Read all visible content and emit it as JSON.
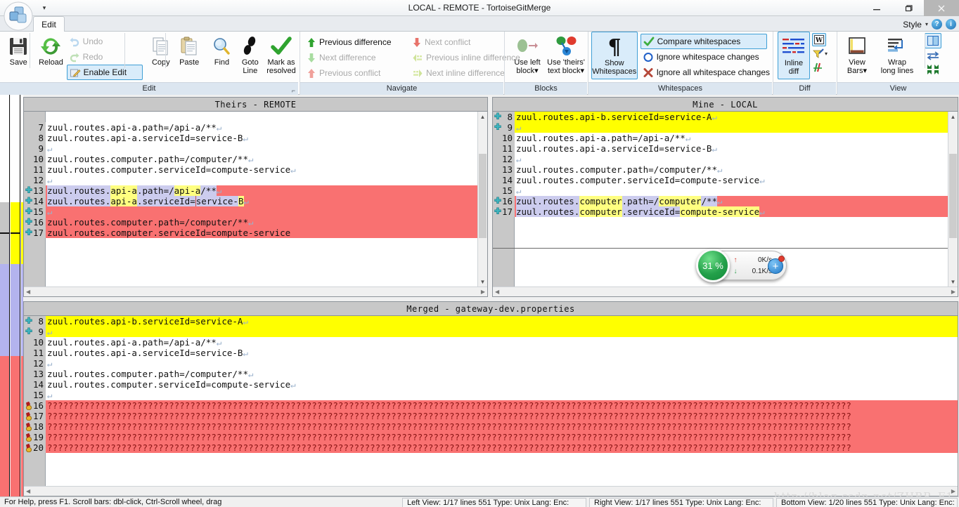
{
  "window": {
    "title": "LOCAL - REMOTE - TortoiseGitMerge",
    "minimize": "–",
    "maximize": "❐",
    "close": "×",
    "qat_icon": "quick-access-dropdown"
  },
  "ribbon": {
    "tab": "Edit",
    "style_label": "Style",
    "style_arrow": "▾",
    "help_glyph": "?",
    "info_glyph": "i",
    "groups": [
      {
        "name": "Edit",
        "label": "Edit",
        "big_buttons": [
          {
            "label": "Save",
            "icon": "floppy-disk-icon",
            "enabled": true
          },
          {
            "label": "Reload",
            "icon": "reload-arrows-icon",
            "enabled": true
          },
          {
            "label": "Copy",
            "icon": "copy-pages-icon",
            "enabled": true
          },
          {
            "label": "Paste",
            "icon": "paste-clipboard-icon",
            "enabled": false
          },
          {
            "label": "Find",
            "icon": "magnifier-icon",
            "enabled": true
          },
          {
            "label": "Goto\nLine",
            "label_l1": "Goto",
            "label_l2": "Line",
            "icon": "footprints-icon",
            "enabled": true
          },
          {
            "label": "Mark as resolved",
            "label_l1": "Mark as",
            "label_l2": "resolved",
            "icon": "green-check-icon",
            "enabled": true
          }
        ],
        "small_buttons": [
          {
            "label": "Undo",
            "icon": "undo-arrow-icon",
            "enabled": false
          },
          {
            "label": "Redo",
            "icon": "redo-arrow-icon",
            "enabled": false
          },
          {
            "label": "Enable Edit",
            "icon": "pencil-edit-icon",
            "enabled": true,
            "selected": true
          }
        ]
      },
      {
        "name": "Navigate",
        "label": "Navigate",
        "small_buttons": [
          {
            "label": "Previous difference",
            "icon": "arrow-up-green-icon",
            "enabled": true
          },
          {
            "label": "Next conflict",
            "icon": "arrow-down-red-icon",
            "enabled": false
          },
          {
            "label": "Next difference",
            "icon": "arrow-down-green-icon",
            "enabled": false
          },
          {
            "label": "Previous inline difference",
            "icon": "inline-prev-icon",
            "enabled": false
          },
          {
            "label": "Previous conflict",
            "icon": "arrow-up-red-icon",
            "enabled": false
          },
          {
            "label": "Next inline difference",
            "icon": "inline-next-icon",
            "enabled": false
          }
        ]
      },
      {
        "name": "Blocks",
        "label": "Blocks",
        "big_buttons": [
          {
            "label_l1": "Use left",
            "label_l2": "block",
            "icon": "use-left-block-icon",
            "enabled": false,
            "dropdown": true
          },
          {
            "label_l1": "Use 'theirs'",
            "label_l2": "text block",
            "icon": "use-theirs-block-icon",
            "enabled": true,
            "dropdown": true
          }
        ]
      },
      {
        "name": "Whitespaces",
        "label": "Whitespaces",
        "big_buttons": [
          {
            "label_l1": "Show",
            "label_l2": "Whitespaces",
            "icon": "pilcrow-icon",
            "enabled": true,
            "selected": true
          }
        ],
        "small_buttons": [
          {
            "label": "Compare whitespaces",
            "icon": "green-check-icon",
            "enabled": true,
            "selected": true
          },
          {
            "label": "Ignore whitespace changes",
            "icon": "blue-circle-icon",
            "enabled": true
          },
          {
            "label": "Ignore all whitespace changes",
            "icon": "red-x-icon",
            "enabled": true
          }
        ]
      },
      {
        "name": "Diff",
        "label": "Diff",
        "big_buttons": [
          {
            "label_l1": "Inline",
            "label_l2": "diff",
            "icon": "inline-diff-lines-icon",
            "enabled": true,
            "selected": true
          }
        ],
        "side_icons": [
          {
            "icon": "word-diff-icon",
            "selected": true
          },
          {
            "icon": "highlighter-pen-icon",
            "dropdown": true
          },
          {
            "icon": "hash-strokes-icon"
          }
        ]
      },
      {
        "name": "View",
        "label": "View",
        "big_buttons": [
          {
            "label_l1": "View",
            "label_l2": "Bars",
            "icon": "view-bars-icon",
            "enabled": true,
            "dropdown": true
          },
          {
            "label_l1": "Wrap",
            "label_l2": "long lines",
            "icon": "wrap-lines-icon",
            "enabled": true
          }
        ],
        "side_icons": [
          {
            "icon": "two-pane-layout-icon",
            "selected": true
          },
          {
            "icon": "swap-arrows-icon"
          },
          {
            "icon": "collapse-arrows-icon"
          }
        ]
      }
    ]
  },
  "panes": {
    "left": {
      "title": "Theirs - REMOTE",
      "lines": [
        {
          "num": "",
          "text": "",
          "bg": "blank-gray",
          "mark": ""
        },
        {
          "num": "7",
          "text": "zuul.routes.api-a.path=/api-a/**",
          "eol": true,
          "bg": "white",
          "mark": ""
        },
        {
          "num": "8",
          "text": "zuul.routes.api-a.serviceId=service-B",
          "eol": true,
          "bg": "white",
          "mark": ""
        },
        {
          "num": "9",
          "text": "",
          "eol": true,
          "bg": "white",
          "mark": ""
        },
        {
          "num": "10",
          "text": "zuul.routes.computer.path=/computer/**",
          "eol": true,
          "bg": "white",
          "mark": ""
        },
        {
          "num": "11",
          "text": "zuul.routes.computer.serviceId=compute-service",
          "eol": true,
          "bg": "white",
          "mark": ""
        },
        {
          "num": "12",
          "text": "",
          "eol": true,
          "bg": "white",
          "mark": ""
        },
        {
          "num": "13",
          "text": "zuul.routes.api-a.path=/api-a/**",
          "eol": true,
          "bg": "red",
          "mark": "plus",
          "inline": true
        },
        {
          "num": "14",
          "text": "zuul.routes.api-a.serviceId=service-B",
          "eol": true,
          "bg": "red",
          "mark": "plus",
          "inline": true
        },
        {
          "num": "15",
          "text": "",
          "eol": true,
          "bg": "red",
          "mark": "plus"
        },
        {
          "num": "16",
          "text": "zuul.routes.computer.path=/computer/**",
          "eol": true,
          "bg": "red",
          "mark": "plus"
        },
        {
          "num": "17",
          "text": "zuul.routes.computer.serviceId=compute-service",
          "eol": false,
          "bg": "red",
          "mark": "plus"
        }
      ]
    },
    "right": {
      "title": "Mine - LOCAL",
      "lines": [
        {
          "num": "8",
          "text": "zuul.routes.api-b.serviceId=service-A",
          "eol": true,
          "bg": "yellow",
          "mark": "plus"
        },
        {
          "num": "9",
          "text": "",
          "eol": true,
          "bg": "yellow",
          "mark": "plus"
        },
        {
          "num": "10",
          "text": "zuul.routes.api-a.path=/api-a/**",
          "eol": true,
          "bg": "white",
          "mark": ""
        },
        {
          "num": "11",
          "text": "zuul.routes.api-a.serviceId=service-B",
          "eol": true,
          "bg": "white",
          "mark": ""
        },
        {
          "num": "12",
          "text": "",
          "eol": true,
          "bg": "white",
          "mark": ""
        },
        {
          "num": "13",
          "text": "zuul.routes.computer.path=/computer/**",
          "eol": true,
          "bg": "white",
          "mark": ""
        },
        {
          "num": "14",
          "text": "zuul.routes.computer.serviceId=compute-service",
          "eol": true,
          "bg": "white",
          "mark": ""
        },
        {
          "num": "15",
          "text": "",
          "eol": true,
          "bg": "white",
          "mark": ""
        },
        {
          "num": "16",
          "text": "zuul.routes.computer.path=/computer/**",
          "eol": true,
          "bg": "red",
          "mark": "plus",
          "inline": true
        },
        {
          "num": "17",
          "text": "zuul.routes.computer.serviceId=compute-service",
          "eol": true,
          "bg": "red",
          "mark": "plus",
          "inline": true
        },
        {
          "num": "",
          "text": "",
          "bg": "red",
          "mark": ""
        },
        {
          "num": "",
          "text": "",
          "bg": "red",
          "mark": ""
        },
        {
          "num": "",
          "text": "",
          "bg": "red",
          "mark": ""
        }
      ]
    },
    "merged": {
      "title": "Merged - gateway-dev.properties",
      "lines": [
        {
          "num": "8",
          "text": "zuul.routes.api-b.serviceId=service-A",
          "eol": true,
          "bg": "yellow",
          "mark": "plus"
        },
        {
          "num": "9",
          "text": "",
          "eol": true,
          "bg": "yellow",
          "mark": "plus"
        },
        {
          "num": "10",
          "text": "zuul.routes.api-a.path=/api-a/**",
          "eol": true,
          "bg": "white",
          "mark": ""
        },
        {
          "num": "11",
          "text": "zuul.routes.api-a.serviceId=service-B",
          "eol": true,
          "bg": "white",
          "mark": ""
        },
        {
          "num": "12",
          "text": "",
          "eol": true,
          "bg": "white",
          "mark": ""
        },
        {
          "num": "13",
          "text": "zuul.routes.computer.path=/computer/**",
          "eol": true,
          "bg": "white",
          "mark": ""
        },
        {
          "num": "14",
          "text": "zuul.routes.computer.serviceId=compute-service",
          "eol": true,
          "bg": "white",
          "mark": ""
        },
        {
          "num": "15",
          "text": "",
          "eol": true,
          "bg": "white",
          "mark": ""
        },
        {
          "num": "16",
          "text": "????????????????????????????????????????????????????????????????????????????????????????????????????????????????????????????????????????????????????????",
          "bg": "red",
          "mark": "conflict"
        },
        {
          "num": "17",
          "text": "????????????????????????????????????????????????????????????????????????????????????????????????????????????????????????????????????????????????????????",
          "bg": "red",
          "mark": "conflict"
        },
        {
          "num": "18",
          "text": "????????????????????????????????????????????????????????????????????????????????????????????????????????????????????????????????????????????????????????",
          "bg": "red",
          "mark": "conflict"
        },
        {
          "num": "19",
          "text": "????????????????????????????????????????????????????????????????????????????????????????????????????????????????????????????????????????????????????????",
          "bg": "red",
          "mark": "conflict"
        },
        {
          "num": "20",
          "text": "????????????????????????????????????????????????????????????????????????????????????????????????????????????????????????????????????????????????????????",
          "bg": "red",
          "mark": "conflict"
        }
      ]
    }
  },
  "network_widget": {
    "percent": "31 %",
    "up_value": "0K/s",
    "down_value": "0.1K/s",
    "up_arrow": "↑",
    "down_arrow": "↓",
    "plus_glyph": "+"
  },
  "statusbar": {
    "help_text": "For Help, press F1. Scroll bars: dbl-click, Ctrl-Scroll wheel, drag",
    "panel_left": "Left View: 1/17 lines  551 Type: Unix Lang: Enc: ",
    "panel_mid": "Right View: 1/17 lines  551 Type: Unix Lang: Enc: ",
    "panel_right": "Bottom View: 1/20 lines  551 Type: Unix Lang: Enc: "
  },
  "watermark": "http://blog.csdn.net/ZHBR_F1",
  "colors": {
    "conflict_red": "#f97171",
    "added_yellow": "#ffff00",
    "inline_word": "#ffff80",
    "inline_line": "#ccccee",
    "gutter_gray": "#c8c8c8",
    "loc_blue": "#b3b3ee"
  },
  "location_bars": {
    "top_segments": [
      {
        "color": "#ffffff",
        "from": 0,
        "to": 0.53
      },
      {
        "color": "#ffff00",
        "from": 0.53,
        "to": 0.78
      },
      {
        "color": "#b3b3ee",
        "from": 0.78,
        "to": 1.0
      }
    ]
  }
}
